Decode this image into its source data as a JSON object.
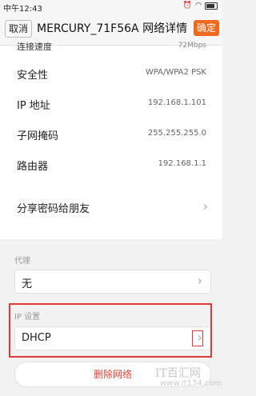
{
  "status": {
    "time": "中午12:43"
  },
  "header": {
    "cancel": "取消",
    "title": "MERCURY_71F56A 网络详情",
    "confirm": "确定"
  },
  "rows": [
    {
      "label": "连接速度",
      "value": "72Mbps"
    },
    {
      "label": "安全性",
      "value": "WPA/WPA2 PSK"
    },
    {
      "label": "IP 地址",
      "value": "192.168.1.101"
    },
    {
      "label": "子网掩码",
      "value": "255.255.255.0"
    },
    {
      "label": "路由器",
      "value": "192.168.1.1"
    }
  ],
  "share": {
    "label": "分享密码给朋友"
  },
  "proxy": {
    "section": "代理",
    "value": "无"
  },
  "ip_settings": {
    "section": "IP 设置",
    "value": "DHCP"
  },
  "delete_label": "删除网络",
  "watermark": {
    "line1": "IT百汇网",
    "line2": "www.it134.com"
  }
}
